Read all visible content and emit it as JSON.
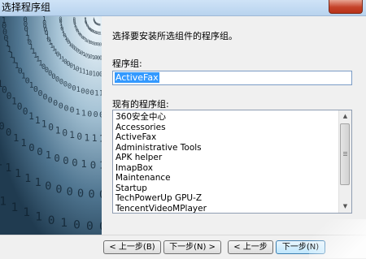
{
  "window": {
    "title": "选择程序组"
  },
  "content": {
    "instruction": "选择要安装所选组件的程序组。",
    "group_label": "程序组:",
    "group_value": "ActiveFax",
    "existing_label": "现有的程序组:",
    "groups": [
      "360安全中心",
      "Accessories",
      "ActiveFax",
      "Administrative Tools",
      "APK helper",
      "ImapBox",
      "Maintenance",
      "Startup",
      "TechPowerUp GPU-Z",
      "TencentVideoMPlayer"
    ]
  },
  "buttons": {
    "back_1": "< 上一步(B)",
    "next_1": "下一步(N) >",
    "back_2": "< 上一步",
    "next_2": "下一步(N)"
  },
  "colors": {
    "selection": "#3399ff",
    "titlebar": "#c4dbf2",
    "close": "#c5432a"
  }
}
